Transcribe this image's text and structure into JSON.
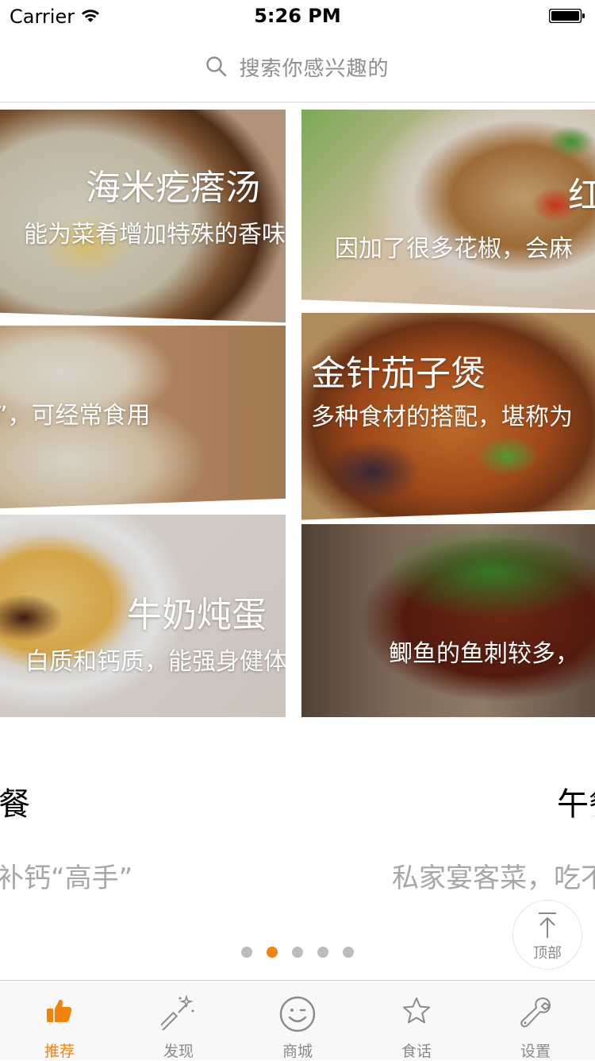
{
  "status_bar": {
    "carrier": "Carrier",
    "time": "5:26 PM"
  },
  "search": {
    "placeholder": "搜索你感兴趣的",
    "icon": "search-icon"
  },
  "tiles": {
    "left": [
      {
        "title": "海米疙瘩汤",
        "subtitle": "能为菜肴增加特殊的香味"
      },
      {
        "title": "",
        "subtitle": "”，可经常食用"
      },
      {
        "title": "牛奶炖蛋",
        "subtitle": "白质和钙质，能强身健体"
      }
    ],
    "right": [
      {
        "title": "红",
        "subtitle": "因加了很多花椒，会麻"
      },
      {
        "title": "金针茄子煲",
        "subtitle": "多种食材的搭配，堪称为"
      },
      {
        "title": "",
        "subtitle": "鲫鱼的鱼刺较多，"
      }
    ]
  },
  "meals": [
    {
      "title": "餐",
      "desc": "补钙“高手”"
    },
    {
      "title": "午餐",
      "desc": "私家宴客菜，吃不"
    }
  ],
  "back_to_top": {
    "label": "顶部",
    "icon": "arrow-up-icon"
  },
  "pagination": {
    "count": 5,
    "active_index": 1
  },
  "tab_bar": {
    "items": [
      {
        "label": "推荐",
        "icon": "thumbs-up-icon",
        "active": true
      },
      {
        "label": "发现",
        "icon": "magic-wand-icon",
        "active": false
      },
      {
        "label": "商城",
        "icon": "smiley-icon",
        "active": false
      },
      {
        "label": "食话",
        "icon": "star-icon",
        "active": false
      },
      {
        "label": "设置",
        "icon": "wrench-icon",
        "active": false
      }
    ]
  },
  "colors": {
    "accent": "#f4820a",
    "tab_inactive": "#8a8a8a",
    "muted_text": "#a7a7a7"
  }
}
